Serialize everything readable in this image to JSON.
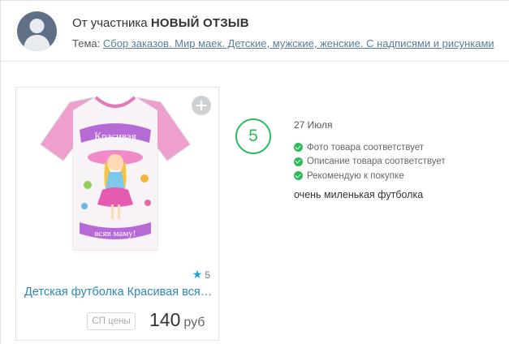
{
  "header": {
    "from_prefix": "От участника",
    "from_title": "НОВЫЙ ОТЗЫВ",
    "topic_label": "Тема:",
    "topic_link": "Сбор заказов. Мир маек. Детские, мужские, женские. С надписями и рисунками"
  },
  "product": {
    "image_caption_top": "Красивая",
    "image_caption_bottom": "всяв маму!",
    "rating": "5",
    "name": "Детская футболка Красивая вся ...",
    "sp_badge": "СП цены",
    "price": "140",
    "currency": "руб"
  },
  "review": {
    "score": "5",
    "date": "27 Июля",
    "checks": [
      "Фото товара соответствует",
      "Описание товара соответствует",
      "Рекомендую к покупке"
    ],
    "text": "очень миленькая футболка"
  },
  "colors": {
    "accent_green": "#2dba5a",
    "link_blue": "#2e86b8",
    "star_blue": "#1fa2d8",
    "avatar_bg": "#5f6f86"
  },
  "icons": {
    "avatar": "user-silhouette-icon",
    "plus": "plus-circle-icon",
    "star": "star-icon",
    "check": "check-circle-icon"
  }
}
